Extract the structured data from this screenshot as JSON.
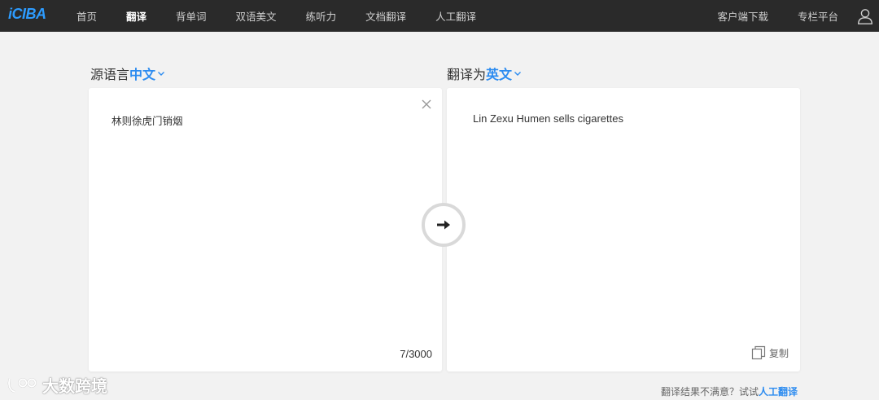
{
  "nav": {
    "logo": "iCIBA",
    "items": [
      {
        "label": "首页",
        "active": false
      },
      {
        "label": "翻译",
        "active": true
      },
      {
        "label": "背单词",
        "active": false
      },
      {
        "label": "双语美文",
        "active": false
      },
      {
        "label": "练听力",
        "active": false
      },
      {
        "label": "文档翻译",
        "active": false
      },
      {
        "label": "人工翻译",
        "active": false
      }
    ],
    "right": {
      "download": "客户端下载",
      "column": "专栏平台"
    }
  },
  "source": {
    "prefix": "源语言",
    "lang": "中文",
    "text": "林则徐虎门销烟",
    "count": "7/3000"
  },
  "target": {
    "prefix": "翻译为",
    "lang": "英文",
    "text": "Lin Zexu Humen sells cigarettes",
    "copy_label": "复制"
  },
  "footer": {
    "hint": "翻译结果不满意？试试",
    "link": "人工翻译"
  },
  "watermark": {
    "text": "大数跨境"
  },
  "colors": {
    "nav_bg": "#2a2a2a",
    "accent": "#2d8cf0",
    "logo": "#2d9cff",
    "page_bg": "#f2f2f2"
  }
}
